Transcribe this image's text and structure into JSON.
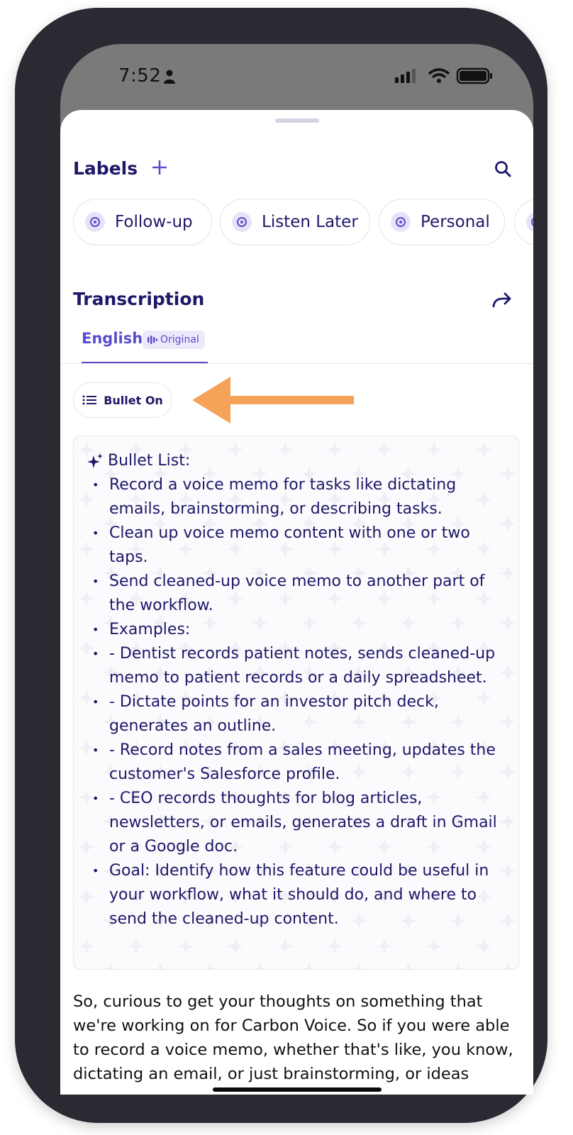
{
  "status_bar": {
    "time": "7:52"
  },
  "labels": {
    "title": "Labels",
    "chips": [
      "Follow-up",
      "Listen Later",
      "Personal"
    ]
  },
  "transcription": {
    "title": "Transcription",
    "tab_label": "English",
    "tab_badge": "Original",
    "bullet_button": "Bullet On"
  },
  "summary": {
    "heading": "Bullet List:",
    "items": [
      "Record a voice memo for tasks like dictating emails, brainstorming, or describing tasks.",
      "Clean up voice memo content with one or two taps.",
      "Send cleaned-up voice memo to another part of the workflow.",
      "Examples:",
      "- Dentist records patient notes, sends cleaned-up memo to patient records or a daily spreadsheet.",
      "- Dictate points for an investor pitch deck, generates an outline.",
      "- Record notes from a sales meeting, updates the customer's Salesforce profile.",
      "- CEO records thoughts for blog articles, newsletters, or emails, generates a draft in Gmail or a Google doc.",
      "Goal: Identify how this feature could be useful in your workflow, what it should do, and where to send the cleaned-up content."
    ]
  },
  "transcript_text": "So, curious to get your thoughts on something that we're working on for Carbon Voice. So if you were able to record a voice memo, whether that's like, you know, dictating an email, or just brainstorming, or ideas",
  "colors": {
    "accent": "#5b4ccc",
    "navy": "#1e1868",
    "arrow": "#f6a35a"
  }
}
